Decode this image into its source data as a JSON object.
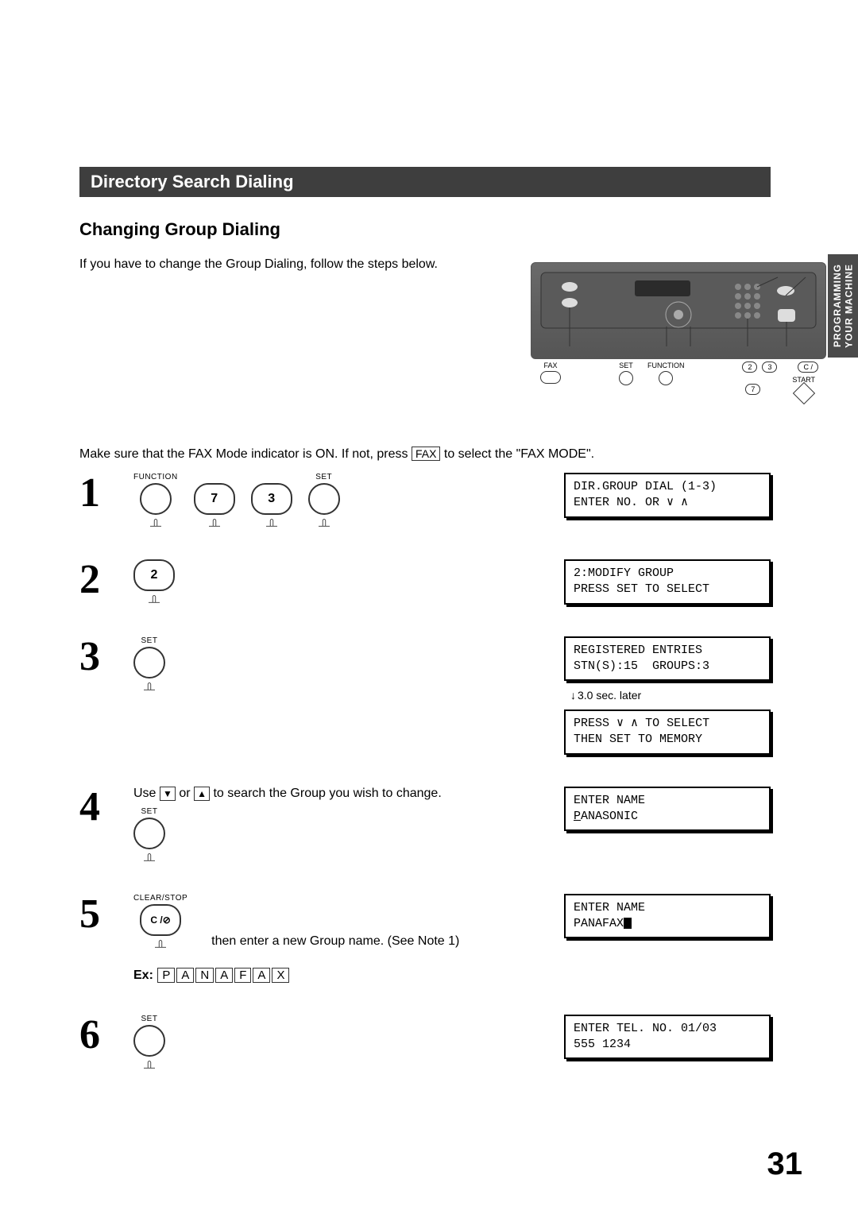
{
  "sideTab": {
    "line1": "PROGRAMMING",
    "line2": "YOUR MACHINE"
  },
  "titleBar": "Directory Search Dialing",
  "subHeading": "Changing Group Dialing",
  "intro": "If you have to change the Group Dialing, follow the steps below.",
  "panelLabels": {
    "fax": "FAX",
    "set": "SET",
    "function": "FUNCTION",
    "start": "START"
  },
  "panelCallouts": {
    "two": "2",
    "three": "3",
    "seven": "7",
    "clear": "C /"
  },
  "modeLine": {
    "pre": "Make sure that the FAX Mode indicator is ON.  If not, press ",
    "faxKey": "FAX",
    "post": " to select the \"FAX MODE\"."
  },
  "buttons": {
    "function": "FUNCTION",
    "set": "SET",
    "seven": "7",
    "three": "3",
    "two": "2",
    "clearStop": "CLEAR/STOP",
    "clearGlyph": "C /⊘"
  },
  "stepNums": {
    "s1": "1",
    "s2": "2",
    "s3": "3",
    "s4": "4",
    "s5": "5",
    "s6": "6"
  },
  "lcd": {
    "d1": "DIR.GROUP DIAL (1-3)\nENTER NO. OR ∨ ∧",
    "d2": "2:MODIFY GROUP\nPRESS SET TO SELECT",
    "d3a": "REGISTERED ENTRIES\nSTN(S):15  GROUPS:3",
    "delay": "3.0 sec. later",
    "d3b": "PRESS ∨ ∧ TO SELECT\nTHEN SET TO MEMORY",
    "d4": "ENTER NAME\nPANASONIC",
    "d5": "ENTER NAME\nPANAFAX▮",
    "d6": "ENTER TEL. NO. 01/03\n555 1234"
  },
  "step4": {
    "pre": "Use ",
    "mid": " or ",
    "post": " to search the Group you wish to change."
  },
  "step5": {
    "note": "then enter a new Group name. (See Note 1)"
  },
  "ex": {
    "label": "Ex:",
    "letters": [
      "P",
      "A",
      "N",
      "A",
      "F",
      "A",
      "X"
    ]
  },
  "pageNumber": "31"
}
